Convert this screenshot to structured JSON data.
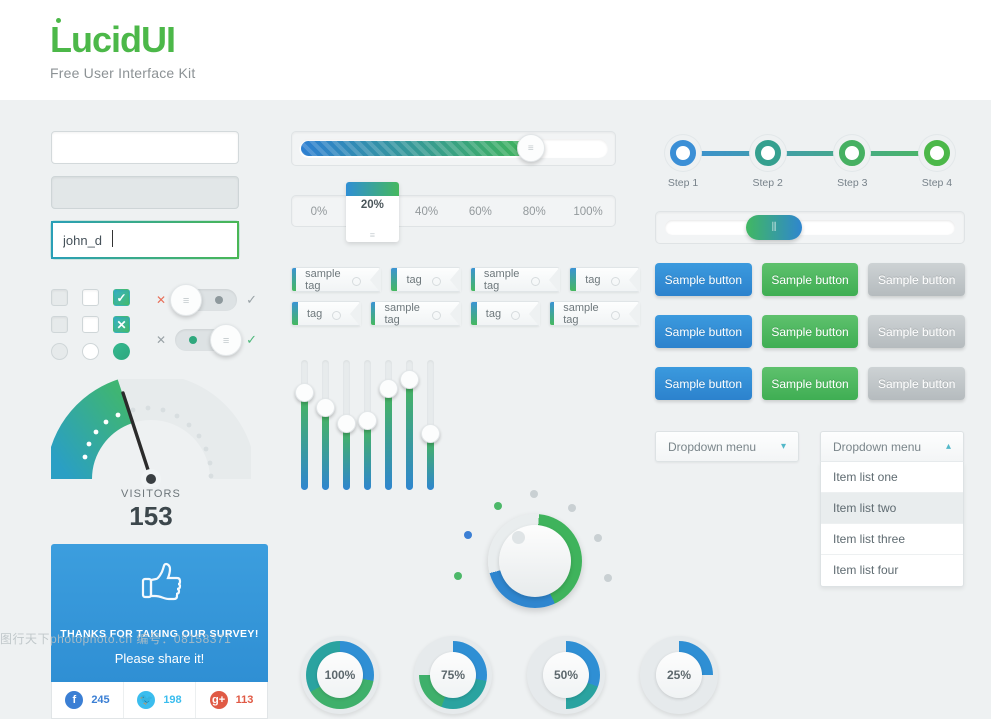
{
  "brand": {
    "name_part1": "Lu",
    "name_dot": "c",
    "name_part2": "idUI",
    "logo_text": "LucidUI",
    "tagline": "Free User Interface Kit",
    "green": "#4cb849",
    "blue": "#2f8fd4"
  },
  "forms": {
    "input_empty_value": "",
    "input_empty_placeholder": "",
    "input_disabled_value": "",
    "input_focused_value": "john_d"
  },
  "toggles": {
    "row1": {
      "off_mark": "✕",
      "on_mark": "✓",
      "state": "off"
    },
    "row2": {
      "off_mark": "✕",
      "on_mark": "✓",
      "state": "on"
    }
  },
  "checks": {
    "checked_mark": "✓",
    "x_mark": "✕"
  },
  "gauge": {
    "label": "VISITORS",
    "value": "153"
  },
  "survey": {
    "icon": "thumbs-up-icon",
    "title": "THANKS FOR TAKING OUR SURVEY!",
    "subtitle": "Please share it!",
    "social": [
      {
        "network": "facebook",
        "glyph": "f",
        "count": "245"
      },
      {
        "network": "twitter",
        "glyph": "t",
        "count": "198"
      },
      {
        "network": "googleplus",
        "glyph": "g+",
        "count": "113"
      }
    ]
  },
  "progress": {
    "percent": 73,
    "handle_glyph": "≡"
  },
  "pctbar": {
    "options": [
      "0%",
      "20%",
      "40%",
      "60%",
      "80%",
      "100%"
    ],
    "selected": "20%",
    "selected_index": 1
  },
  "tags": {
    "row1": [
      "sample tag",
      "tag",
      "sample tag",
      "tag"
    ],
    "row2": [
      "tag",
      "sample tag",
      "tag",
      "sample tag"
    ]
  },
  "equalizer": {
    "values": [
      72,
      60,
      48,
      50,
      75,
      82,
      40
    ]
  },
  "knob": {
    "type": "rotary-knob",
    "dots": [
      "gray",
      "green",
      "blue",
      "green",
      "gray",
      "gray",
      "gray",
      "gray"
    ]
  },
  "donuts": [
    {
      "label": "100%",
      "value": 100
    },
    {
      "label": "75%",
      "value": 75
    },
    {
      "label": "50%",
      "value": 50
    },
    {
      "label": "25%",
      "value": 25
    }
  ],
  "steps": [
    {
      "label": "Step 1",
      "color": "#3b8fd6"
    },
    {
      "label": "Step 2",
      "color": "#35a08f"
    },
    {
      "label": "Step 3",
      "color": "#46b062"
    },
    {
      "label": "Step 4",
      "color": "#4cb849"
    }
  ],
  "range_slider": {
    "value": 30
  },
  "buttons": {
    "rows": [
      [
        {
          "label": "Sample button",
          "style": "blue"
        },
        {
          "label": "Sample button",
          "style": "green"
        },
        {
          "label": "Sample button",
          "style": "gray"
        }
      ],
      [
        {
          "label": "Sample button",
          "style": "blue"
        },
        {
          "label": "Sample button",
          "style": "green"
        },
        {
          "label": "Sample button",
          "style": "gray"
        }
      ],
      [
        {
          "label": "Sample button",
          "style": "blue"
        },
        {
          "label": "Sample button",
          "style": "green"
        },
        {
          "label": "Sample button",
          "style": "gray"
        }
      ]
    ]
  },
  "dropdown_closed": {
    "label": "Dropdown menu",
    "chevron": "▾"
  },
  "dropdown_open": {
    "label": "Dropdown menu",
    "chevron": "▴",
    "items": [
      "Item list one",
      "Item list two",
      "Item list three",
      "Item list four"
    ],
    "highlighted_index": 1
  },
  "watermark": {
    "text": "图行天下photophoto.cn 编号：08158371"
  }
}
